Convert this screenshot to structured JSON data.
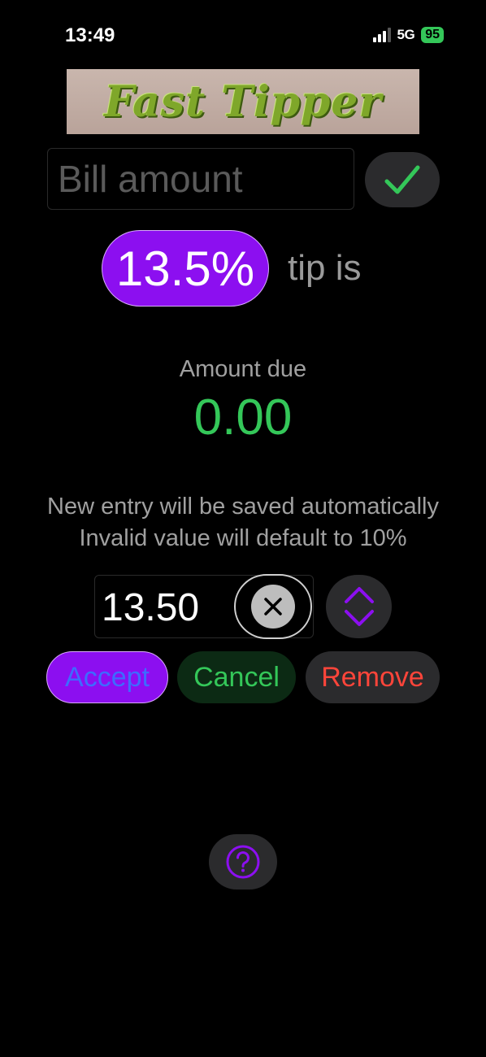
{
  "status_bar": {
    "time": "13:49",
    "network": "5G",
    "battery": "95"
  },
  "logo": {
    "text": "Fast Tipper"
  },
  "bill": {
    "placeholder": "Bill amount",
    "value": ""
  },
  "confirm": {
    "icon": "checkmark-icon",
    "color": "#34c759"
  },
  "tip": {
    "percent_label": "13.5%",
    "suffix": "tip is"
  },
  "amount": {
    "label": "Amount due",
    "value": "0.00"
  },
  "info": {
    "line1": "New entry will be saved automatically",
    "line2": "Invalid value will default to 10%"
  },
  "entry": {
    "value": "13.50"
  },
  "actions": {
    "accept": "Accept",
    "cancel": "Cancel",
    "remove": "Remove"
  },
  "help": {
    "icon": "question-circle-icon",
    "accent": "#8c0ff0"
  }
}
